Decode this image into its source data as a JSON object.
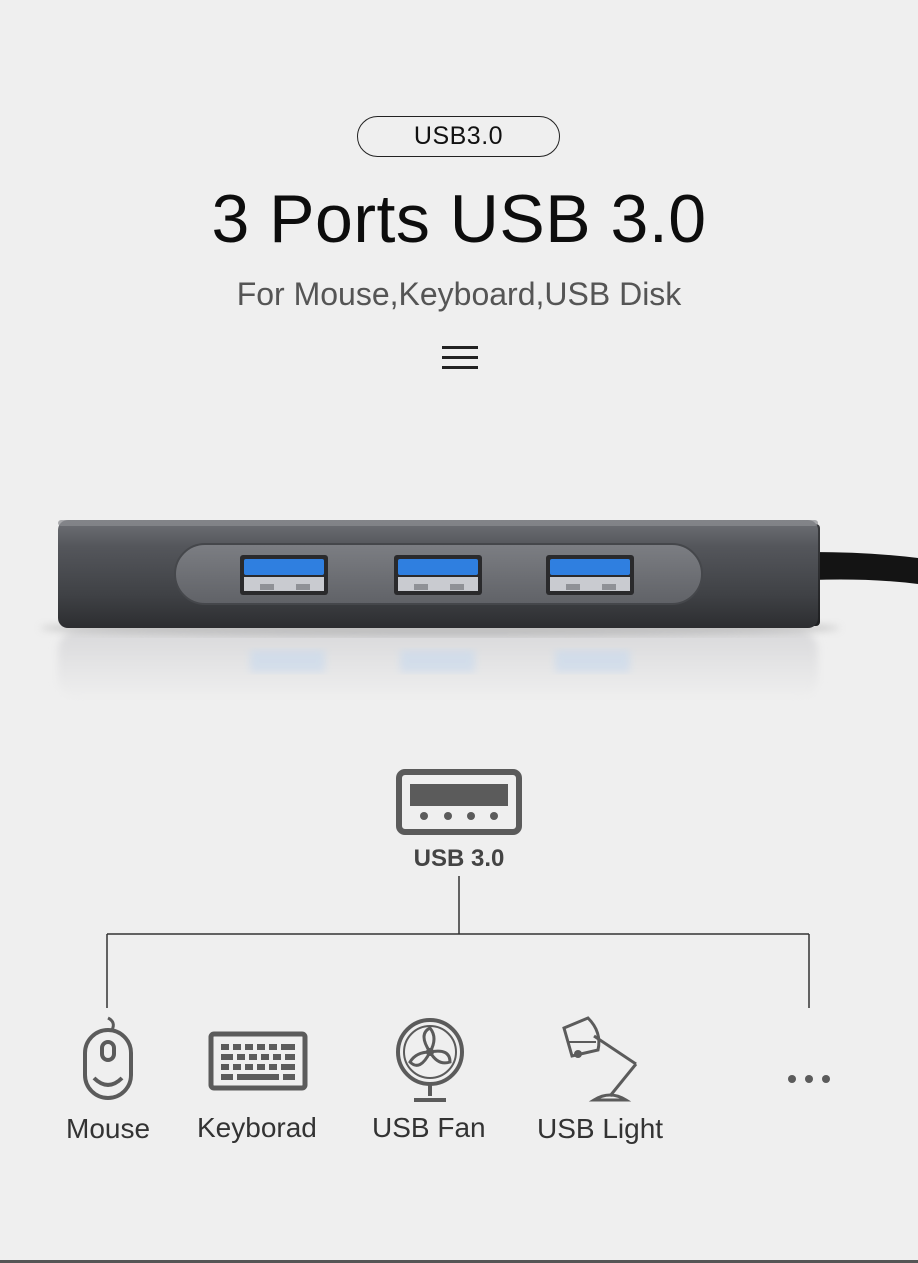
{
  "header": {
    "badge": "USB3.0",
    "title": "3 Ports USB 3.0",
    "subtitle": "For Mouse,Keyboard,USB Disk"
  },
  "diagram": {
    "port_label": "USB 3.0",
    "devices": [
      {
        "label": "Mouse",
        "icon": "mouse-icon"
      },
      {
        "label": "Keyborad",
        "icon": "keyboard-icon"
      },
      {
        "label": "USB Fan",
        "icon": "fan-icon"
      },
      {
        "label": "USB Light",
        "icon": "lamp-icon"
      },
      {
        "label": "",
        "icon": "more-dots-icon"
      }
    ]
  },
  "colors": {
    "background": "#efefef",
    "hub_body": "#4a4c51",
    "port_blue": "#2f7fe0",
    "icon_gray": "#5b5b5b"
  }
}
